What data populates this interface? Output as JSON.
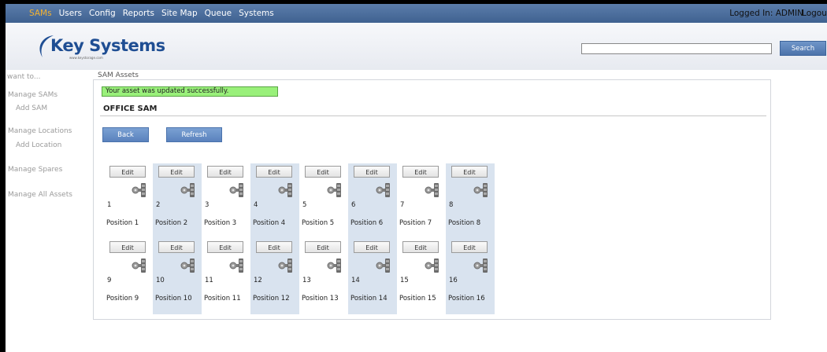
{
  "topbar": {
    "nav": [
      "SAMs",
      "Users",
      "Config",
      "Reports",
      "Site Map",
      "Queue",
      "Systems"
    ],
    "logged_in": "Logged In: ADMIN",
    "logout": "Logout"
  },
  "header": {
    "logo": "Key Systems",
    "logo_sub": "www.keystorage.com",
    "search_placeholder": "",
    "search_label": "Search"
  },
  "sidebar": {
    "title": "want to...",
    "items": [
      {
        "label": "Manage SAMs",
        "children": [
          "Add SAM"
        ]
      },
      {
        "label": "Manage Locations",
        "children": [
          "Add Location"
        ]
      },
      {
        "label": "Manage Spares",
        "children": []
      },
      {
        "label": "Manage All Assets",
        "children": []
      }
    ]
  },
  "main": {
    "breadcrumb": "SAM Assets",
    "success_message": "Your asset was updated successfully.",
    "title": "OFFICE SAM",
    "back_label": "Back",
    "refresh_label": "Refresh",
    "edit_label": "Edit",
    "positions": [
      {
        "number": "1",
        "label": "Position 1"
      },
      {
        "number": "2",
        "label": "Position 2"
      },
      {
        "number": "3",
        "label": "Position 3"
      },
      {
        "number": "4",
        "label": "Position 4"
      },
      {
        "number": "5",
        "label": "Position 5"
      },
      {
        "number": "6",
        "label": "Position 6"
      },
      {
        "number": "7",
        "label": "Position 7"
      },
      {
        "number": "8",
        "label": "Position 8"
      },
      {
        "number": "9",
        "label": "Position 9"
      },
      {
        "number": "10",
        "label": "Position 10"
      },
      {
        "number": "11",
        "label": "Position 11"
      },
      {
        "number": "12",
        "label": "Position 12"
      },
      {
        "number": "13",
        "label": "Position 13"
      },
      {
        "number": "14",
        "label": "Position 14"
      },
      {
        "number": "15",
        "label": "Position 15"
      },
      {
        "number": "16",
        "label": "Position 16"
      }
    ]
  },
  "colors": {
    "topbar": "#4a6c9b",
    "active_nav": "#f2b233",
    "button": "#6b91c8",
    "success_bg": "#99f07a",
    "cell_shade": "#d9e3ef"
  }
}
